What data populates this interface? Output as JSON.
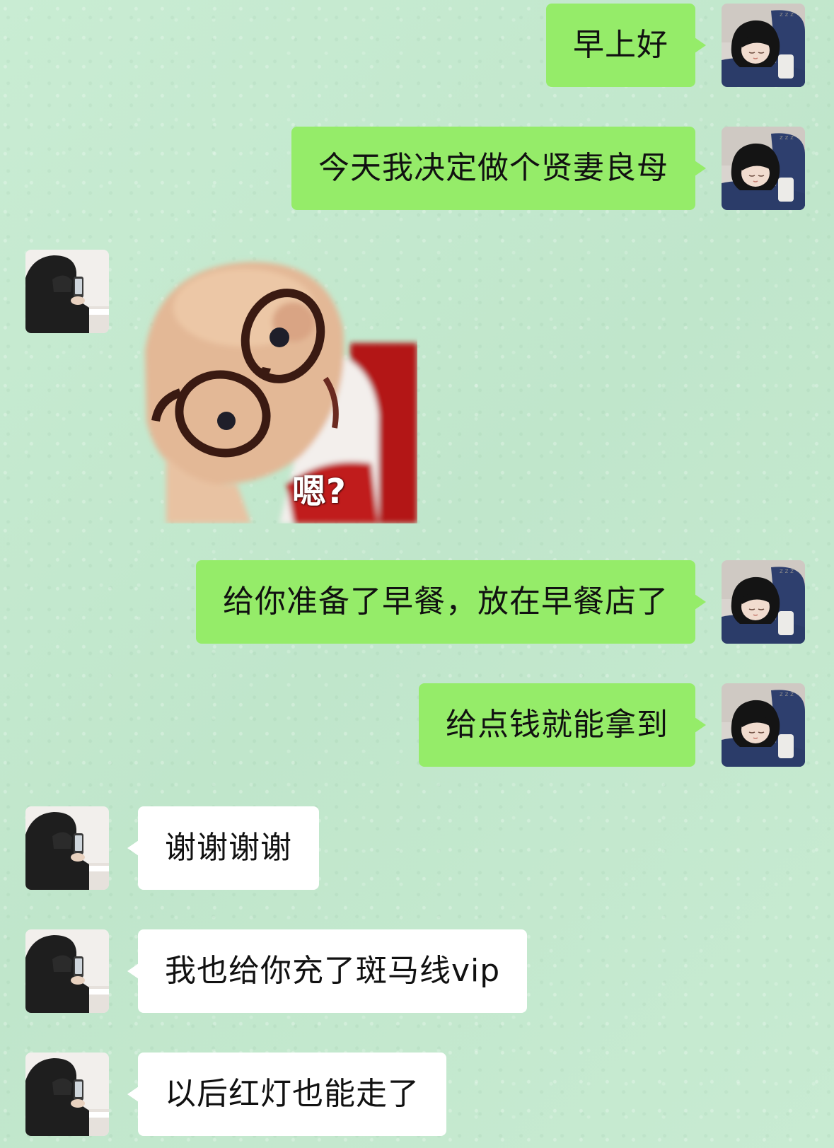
{
  "colors": {
    "sent_bubble": "#95ec69",
    "received_bubble": "#ffffff",
    "background": "#c5e9cf"
  },
  "avatars": {
    "self": "sleeping-girl-avatar",
    "contact": "person-with-phone-avatar"
  },
  "messages": [
    {
      "sender": "self",
      "type": "text",
      "text": "早上好"
    },
    {
      "sender": "self",
      "type": "text",
      "text": "今天我决定做个贤妻良母"
    },
    {
      "sender": "contact",
      "type": "sticker",
      "caption": "嗯?"
    },
    {
      "sender": "self",
      "type": "text",
      "text": "给你准备了早餐，放在早餐店了"
    },
    {
      "sender": "self",
      "type": "text",
      "text": "给点钱就能拿到"
    },
    {
      "sender": "contact",
      "type": "text",
      "text": "谢谢谢谢"
    },
    {
      "sender": "contact",
      "type": "text",
      "text": "我也给你充了斑马线vip"
    },
    {
      "sender": "contact",
      "type": "text",
      "text": "以后红灯也能走了"
    }
  ]
}
